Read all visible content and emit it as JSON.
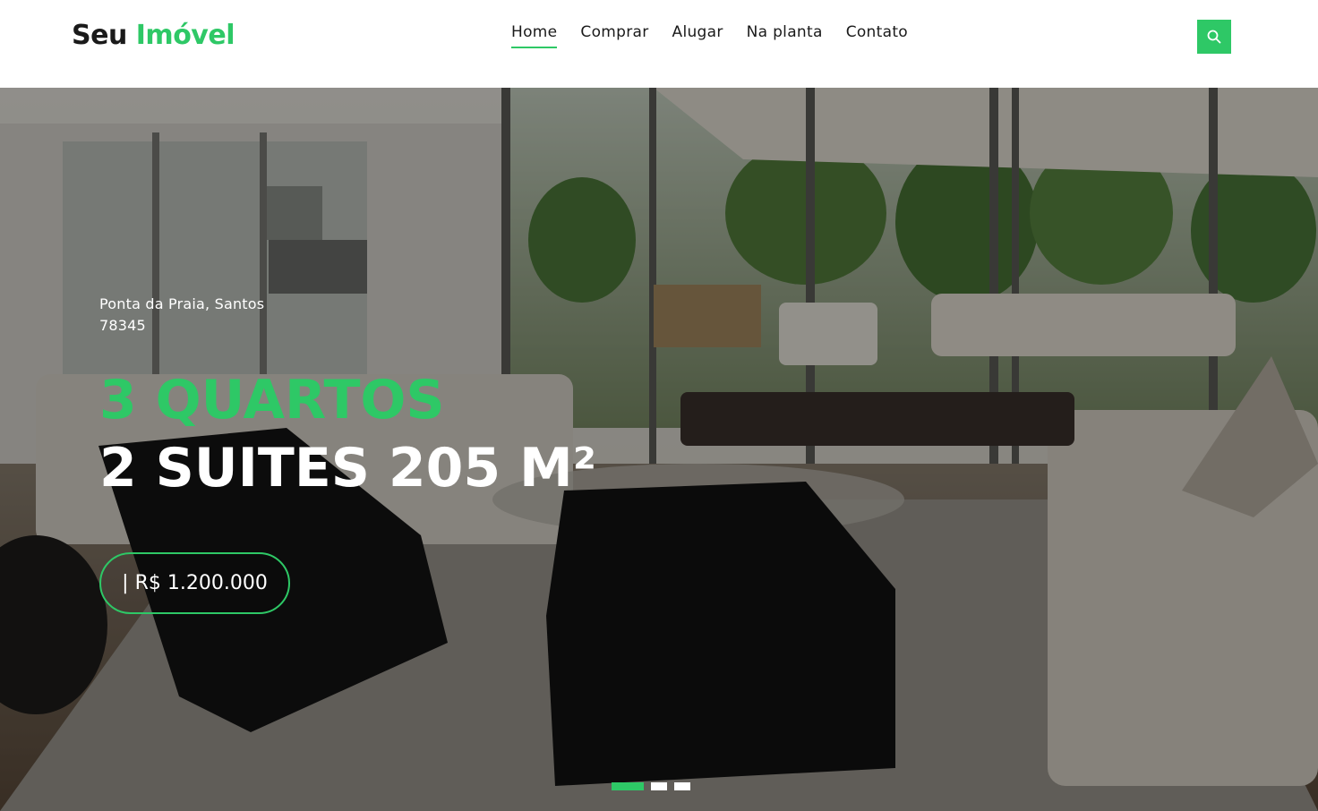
{
  "header": {
    "logo_part1": "Seu",
    "logo_part2": "Imóvel",
    "nav": [
      {
        "label": "Home",
        "active": true
      },
      {
        "label": "Comprar"
      },
      {
        "label": "Alugar"
      },
      {
        "label": "Na planta"
      },
      {
        "label": "Contato"
      }
    ],
    "search_icon": "search-icon"
  },
  "hero": {
    "location_line1": "Ponta da Praia, Santos",
    "location_line2": "78345",
    "headline_1": "3 QUARTOS",
    "headline_2": "2 SUITES 205 M²",
    "price": "| R$ 1.200.000",
    "slides": 3,
    "active_slide": 1
  },
  "colors": {
    "accent": "#2ec866",
    "text_dark": "#1a1a1a"
  }
}
